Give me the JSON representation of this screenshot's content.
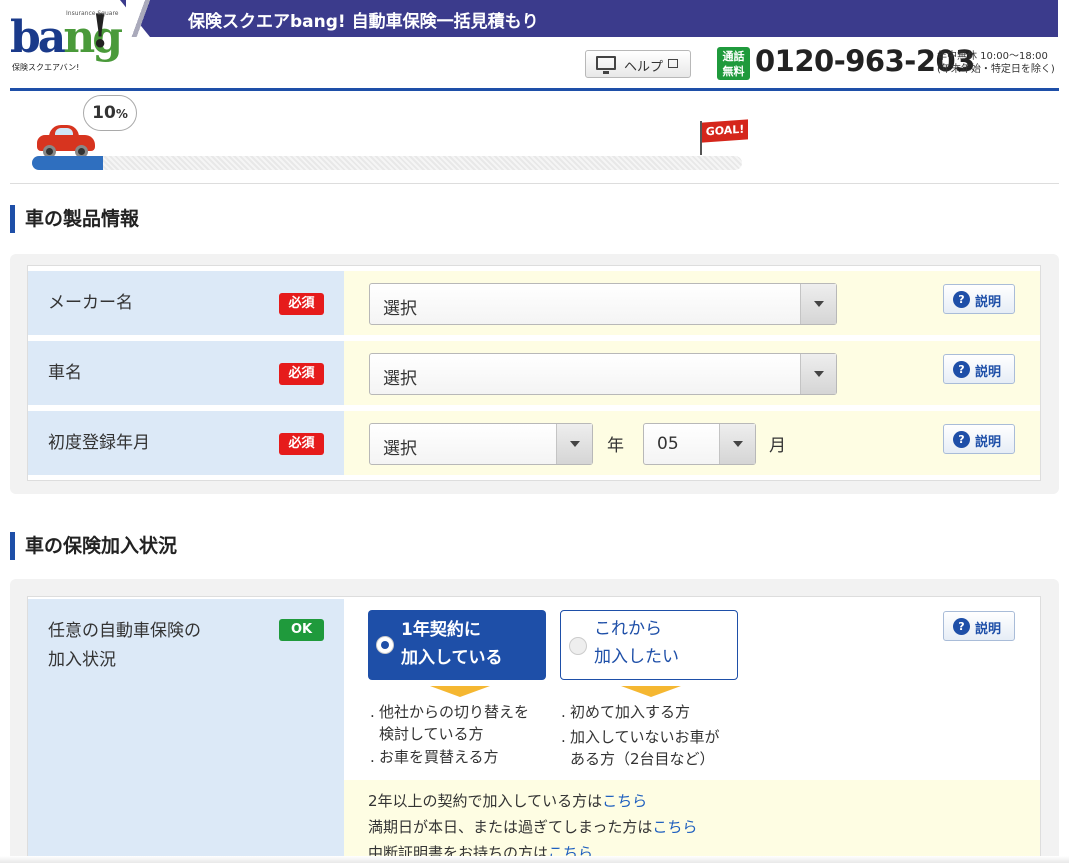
{
  "header": {
    "banner_title": "保険スクエアbang! 自動車保険一括見積もり",
    "logo_text": "bang!",
    "logo_small": "保険スクエアバン!",
    "logo_tiny": "Insurance Square",
    "help_label": "ヘルプ",
    "tel_badge_line1": "通話",
    "tel_badge_line2": "無料",
    "tel_number": "0120-963-203",
    "tel_hours_line1": "年中無休 10:00〜18:00",
    "tel_hours_line2": "(年末年始・特定日を除く)"
  },
  "progress": {
    "percent_label": "10",
    "percent_unit": "%",
    "value": 0.1,
    "goal_label": "GOAL!"
  },
  "section1": {
    "heading": "車の製品情報",
    "rows": [
      {
        "label": "メーカー名",
        "badge": "必須",
        "select_value": "選択",
        "explain": "説明"
      },
      {
        "label": "車名",
        "badge": "必須",
        "select_value": "選択",
        "explain": "説明"
      },
      {
        "label": "初度登録年月",
        "badge": "必須",
        "select_value": "選択",
        "year_unit": "年",
        "month_value": "05",
        "month_unit": "月",
        "explain": "説明"
      }
    ]
  },
  "section2": {
    "heading": "車の保険加入状況",
    "row": {
      "label_line1": "任意の自動車保険の",
      "label_line2": "加入状況",
      "badge": "OK",
      "explain": "説明",
      "option_on_line1": "1年契約に",
      "option_on_line2": "加入している",
      "option_off_line1": "これから",
      "option_off_line2": "加入したい",
      "notes_left": [
        "他社からの切り替えを",
        "検討している方",
        "お車を買替える方"
      ],
      "notes_right": [
        "初めて加入する方",
        "加入していないお車が",
        "ある方（2台目など）"
      ],
      "links": [
        {
          "text": "2年以上の契約で加入している方は",
          "link": "こちら"
        },
        {
          "text": "満期日が本日、または過ぎてしまった方は",
          "link": "こちら"
        },
        {
          "text": "中断証明書をお持ちの方は",
          "link": "こちら"
        }
      ]
    }
  },
  "colors": {
    "primary": "#1e4fa8",
    "required": "#e61b1b",
    "ok": "#1f9a3c",
    "label_bg": "#dce9f7",
    "value_bg": "#fefde3"
  }
}
